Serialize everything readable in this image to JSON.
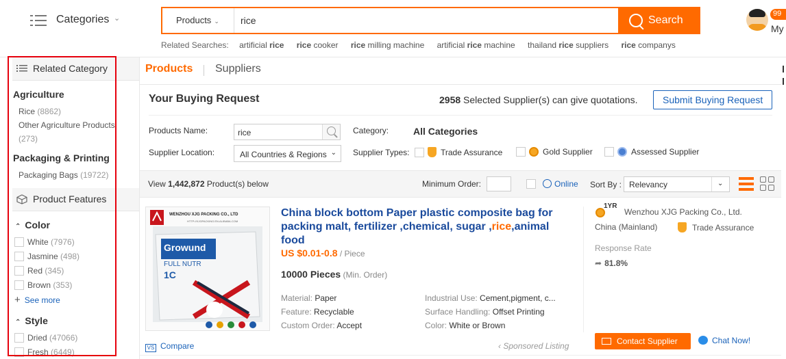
{
  "header": {
    "categories_label": "Categories",
    "search_type": "Products",
    "search_value": "rice",
    "search_button": "Search",
    "related_title": "Related Searches:",
    "related": [
      {
        "pre": "artificial ",
        "kw": "rice",
        "post": ""
      },
      {
        "pre": "",
        "kw": "rice",
        "post": " cooker"
      },
      {
        "pre": "",
        "kw": "rice",
        "post": " milling machine"
      },
      {
        "pre": "artificial ",
        "kw": "rice",
        "post": " machine"
      },
      {
        "pre": "thailand ",
        "kw": "rice",
        "post": " suppliers"
      },
      {
        "pre": "",
        "kw": "rice",
        "post": " companys"
      }
    ],
    "badge": "99",
    "my_label": "My"
  },
  "sidebar": {
    "related_category_title": "Related Category",
    "groups": [
      {
        "name": "Agriculture",
        "items": [
          {
            "label": "Rice",
            "count": "(8862)"
          },
          {
            "label": "Other Agriculture Products",
            "count": "(273)"
          }
        ]
      },
      {
        "name": "Packaging & Printing",
        "items": [
          {
            "label": "Packaging Bags",
            "count": "(19722)"
          }
        ]
      }
    ],
    "product_features_title": "Product Features",
    "color_title": "Color",
    "colors": [
      {
        "label": "White",
        "count": "(7976)"
      },
      {
        "label": "Jasmine",
        "count": "(498)"
      },
      {
        "label": "Red",
        "count": "(345)"
      },
      {
        "label": "Brown",
        "count": "(353)"
      }
    ],
    "see_more": "See more",
    "style_title": "Style",
    "styles": [
      {
        "label": "Dried",
        "count": "(47066)"
      },
      {
        "label": "Fresh",
        "count": "(6449)"
      }
    ]
  },
  "tabs": {
    "products": "Products",
    "suppliers": "Suppliers"
  },
  "buying_request": {
    "title": "Your Buying Request",
    "count": "2958",
    "count_text": " Selected Supplier(s) can give quotations.",
    "submit": "Submit Buying Request",
    "products_name_label": "Products Name:",
    "products_name_value": "rice",
    "category_label": "Category:",
    "category_value": "All Categories",
    "supplier_location_label": "Supplier Location:",
    "supplier_location_value": "All Countries & Regions",
    "supplier_types_label": "Supplier Types:",
    "types": [
      "Trade Assurance",
      "Gold Supplier",
      "Assessed Supplier"
    ]
  },
  "results": {
    "view_pre": "View ",
    "view_count": "1,442,872",
    "view_post": " Product(s) below",
    "minimum_order": "Minimum Order:",
    "online": "Online",
    "sort_by": "Sort By :",
    "sort_value": "Relevancy"
  },
  "product": {
    "image_brand": "WENZHOU XJG PACKING CO., LTD",
    "image_url_text": "HTTP://XJGPACKING.EN.ALIBABA.COM",
    "image_product": "Growund",
    "image_sub": "FULL NUTR",
    "image_code": "1C",
    "title_part1": "China block bottom Paper plastic composite bag for packing malt, fertilizer ,chemical, sugar ,",
    "title_highlight": "rice",
    "title_part2": ",animal food",
    "price": "US $0.01-0.8",
    "price_unit": " / Piece",
    "moq": "10000 Pieces",
    "moq_unit": " (Min. Order)",
    "attrs_left": [
      {
        "k": "Material: ",
        "v": "Paper"
      },
      {
        "k": "Feature: ",
        "v": "Recyclable"
      },
      {
        "k": "Custom Order: ",
        "v": "Accept"
      }
    ],
    "attrs_right": [
      {
        "k": "Industrial Use: ",
        "v": "Cement,pigment, c..."
      },
      {
        "k": "Surface Handling: ",
        "v": "Offset Printing"
      },
      {
        "k": "Color: ",
        "v": "White or Brown"
      }
    ],
    "compare": "Compare",
    "sponsored": "Sponsored Listing",
    "supplier": {
      "years": "1YR",
      "name": "Wenzhou XJG Packing Co., Ltd.",
      "country": "China (Mainland)",
      "trade_assurance": "Trade Assurance",
      "response_rate_label": "Response Rate",
      "response_rate_value": "81.8%",
      "contact": "Contact Supplier",
      "chat": "Chat Now!"
    }
  },
  "colors": {
    "accent": "#ff6a00",
    "link": "#1a62b9",
    "title": "#1a4a9c",
    "highlight_border": "#e6000c"
  }
}
